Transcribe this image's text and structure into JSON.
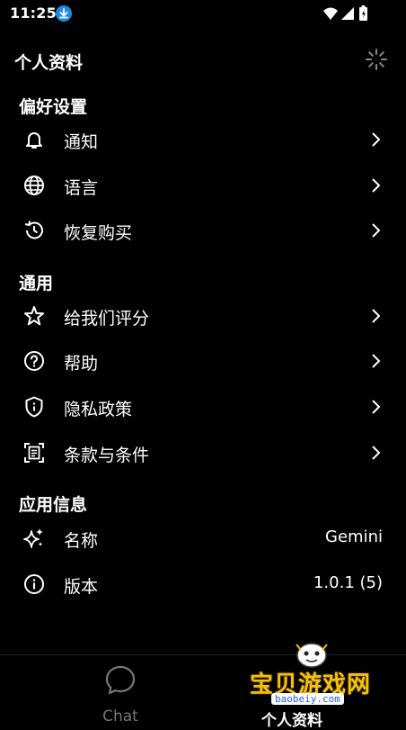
{
  "status_bar": {
    "time": "11:25"
  },
  "header": {
    "title": "个人资料"
  },
  "preferences": {
    "title": "偏好设置",
    "items": [
      {
        "label": "通知"
      },
      {
        "label": "语言"
      },
      {
        "label": "恢复购买"
      }
    ]
  },
  "general": {
    "title": "通用",
    "items": [
      {
        "label": "给我们评分"
      },
      {
        "label": "帮助"
      },
      {
        "label": "隐私政策"
      },
      {
        "label": "条款与条件"
      }
    ]
  },
  "app_info": {
    "title": "应用信息",
    "name_label": "名称",
    "name_value": "Gemini",
    "version_label": "版本",
    "version_value": "1.0.1 (5)"
  },
  "bottom_nav": {
    "chat_label": "Chat",
    "profile_label": "个人资料"
  },
  "watermark": {
    "text": "宝贝游戏网",
    "url": "baobeiy.com"
  },
  "colors": {
    "background": "#000000",
    "text": "#ffffff",
    "inactive": "#777777",
    "download_badge": "#1e88e5"
  }
}
